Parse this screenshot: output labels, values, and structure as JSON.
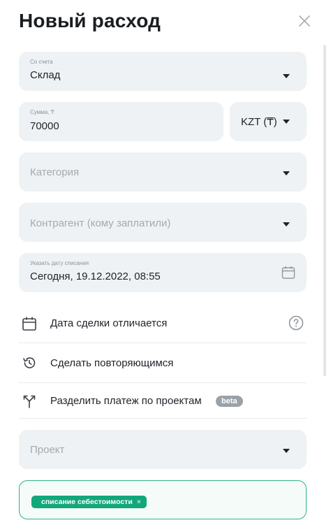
{
  "header": {
    "title": "Новый расход"
  },
  "account": {
    "label": "Со счета",
    "value": "Склад"
  },
  "amount": {
    "label": "Сумма, ₸",
    "value": "70000",
    "currency": "KZT (₸)"
  },
  "category": {
    "placeholder": "Категория"
  },
  "counterparty": {
    "placeholder": "Контрагент (кому заплатили)"
  },
  "writeoff_date": {
    "label": "Указать дату списания",
    "value": "Сегодня, 19.12.2022, 08:55"
  },
  "options": {
    "deal_date": "Дата сделки отличается",
    "recurring": "Сделать повторяющимся",
    "split": "Разделить платеж по проектам",
    "beta_badge": "beta"
  },
  "project": {
    "placeholder": "Проект"
  },
  "tags": [
    {
      "label": "списание себестоимости",
      "remove": "×"
    }
  ],
  "colors": {
    "accent": "#12a77b",
    "field_bg": "#eef2f4",
    "divider": "#e6e9ec"
  }
}
